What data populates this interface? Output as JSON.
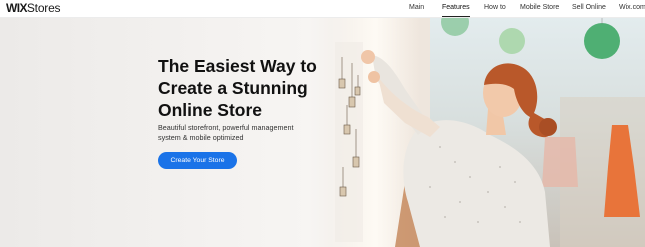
{
  "header": {
    "logo_brand": "WIX",
    "logo_product": "Stores",
    "nav": [
      {
        "label": "Main",
        "active": false
      },
      {
        "label": "Features",
        "active": true
      },
      {
        "label": "How to",
        "active": false
      },
      {
        "label": "Mobile Store",
        "active": false
      },
      {
        "label": "Sell Online",
        "active": false
      },
      {
        "label": "Wix.com",
        "active": false
      }
    ]
  },
  "hero": {
    "headline": "The Easiest Way to Create a Stunning Online Store",
    "subtext": "Beautiful storefront, powerful management system & mobile optimized",
    "cta_label": "Create Your Store",
    "cta_color": "#1a73e8"
  },
  "icons": {
    "hero_photo": "woman-hanging-tags-photo"
  }
}
